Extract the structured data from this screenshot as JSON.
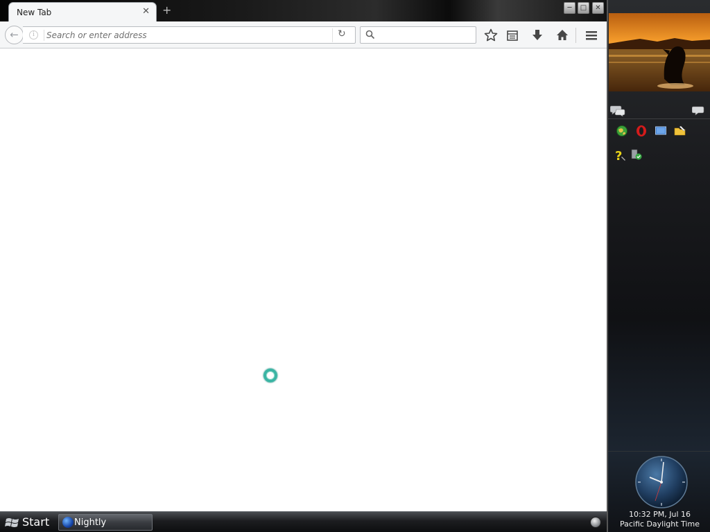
{
  "tab": {
    "title": "New Tab",
    "close_glyph": "✕"
  },
  "new_tab_glyph": "+",
  "window_controls": {
    "minimize": "─",
    "maximize": "□",
    "close": "✕"
  },
  "navbar": {
    "url_placeholder": "Search or enter address",
    "search_placeholder": "",
    "reload_glyph": "↻",
    "back_glyph": "←",
    "icons": [
      "back-icon",
      "info-icon",
      "reload-icon",
      "search-icon",
      "bookmark-star-icon",
      "reading-list-icon",
      "downloads-icon",
      "home-icon",
      "menu-icon"
    ]
  },
  "content": {
    "loading": true,
    "spinner_color": "#3bb5a4"
  },
  "sidebar": {
    "gadgets": [
      "slideshow",
      "feed-headlines",
      "app-launcher",
      "clock"
    ],
    "clock": {
      "time": "10:32 PM, Jul 16",
      "zone": "Pacific Daylight Time"
    }
  },
  "taskbar": {
    "start_label": "Start",
    "tasks": [
      {
        "label": "Nightly"
      }
    ]
  }
}
